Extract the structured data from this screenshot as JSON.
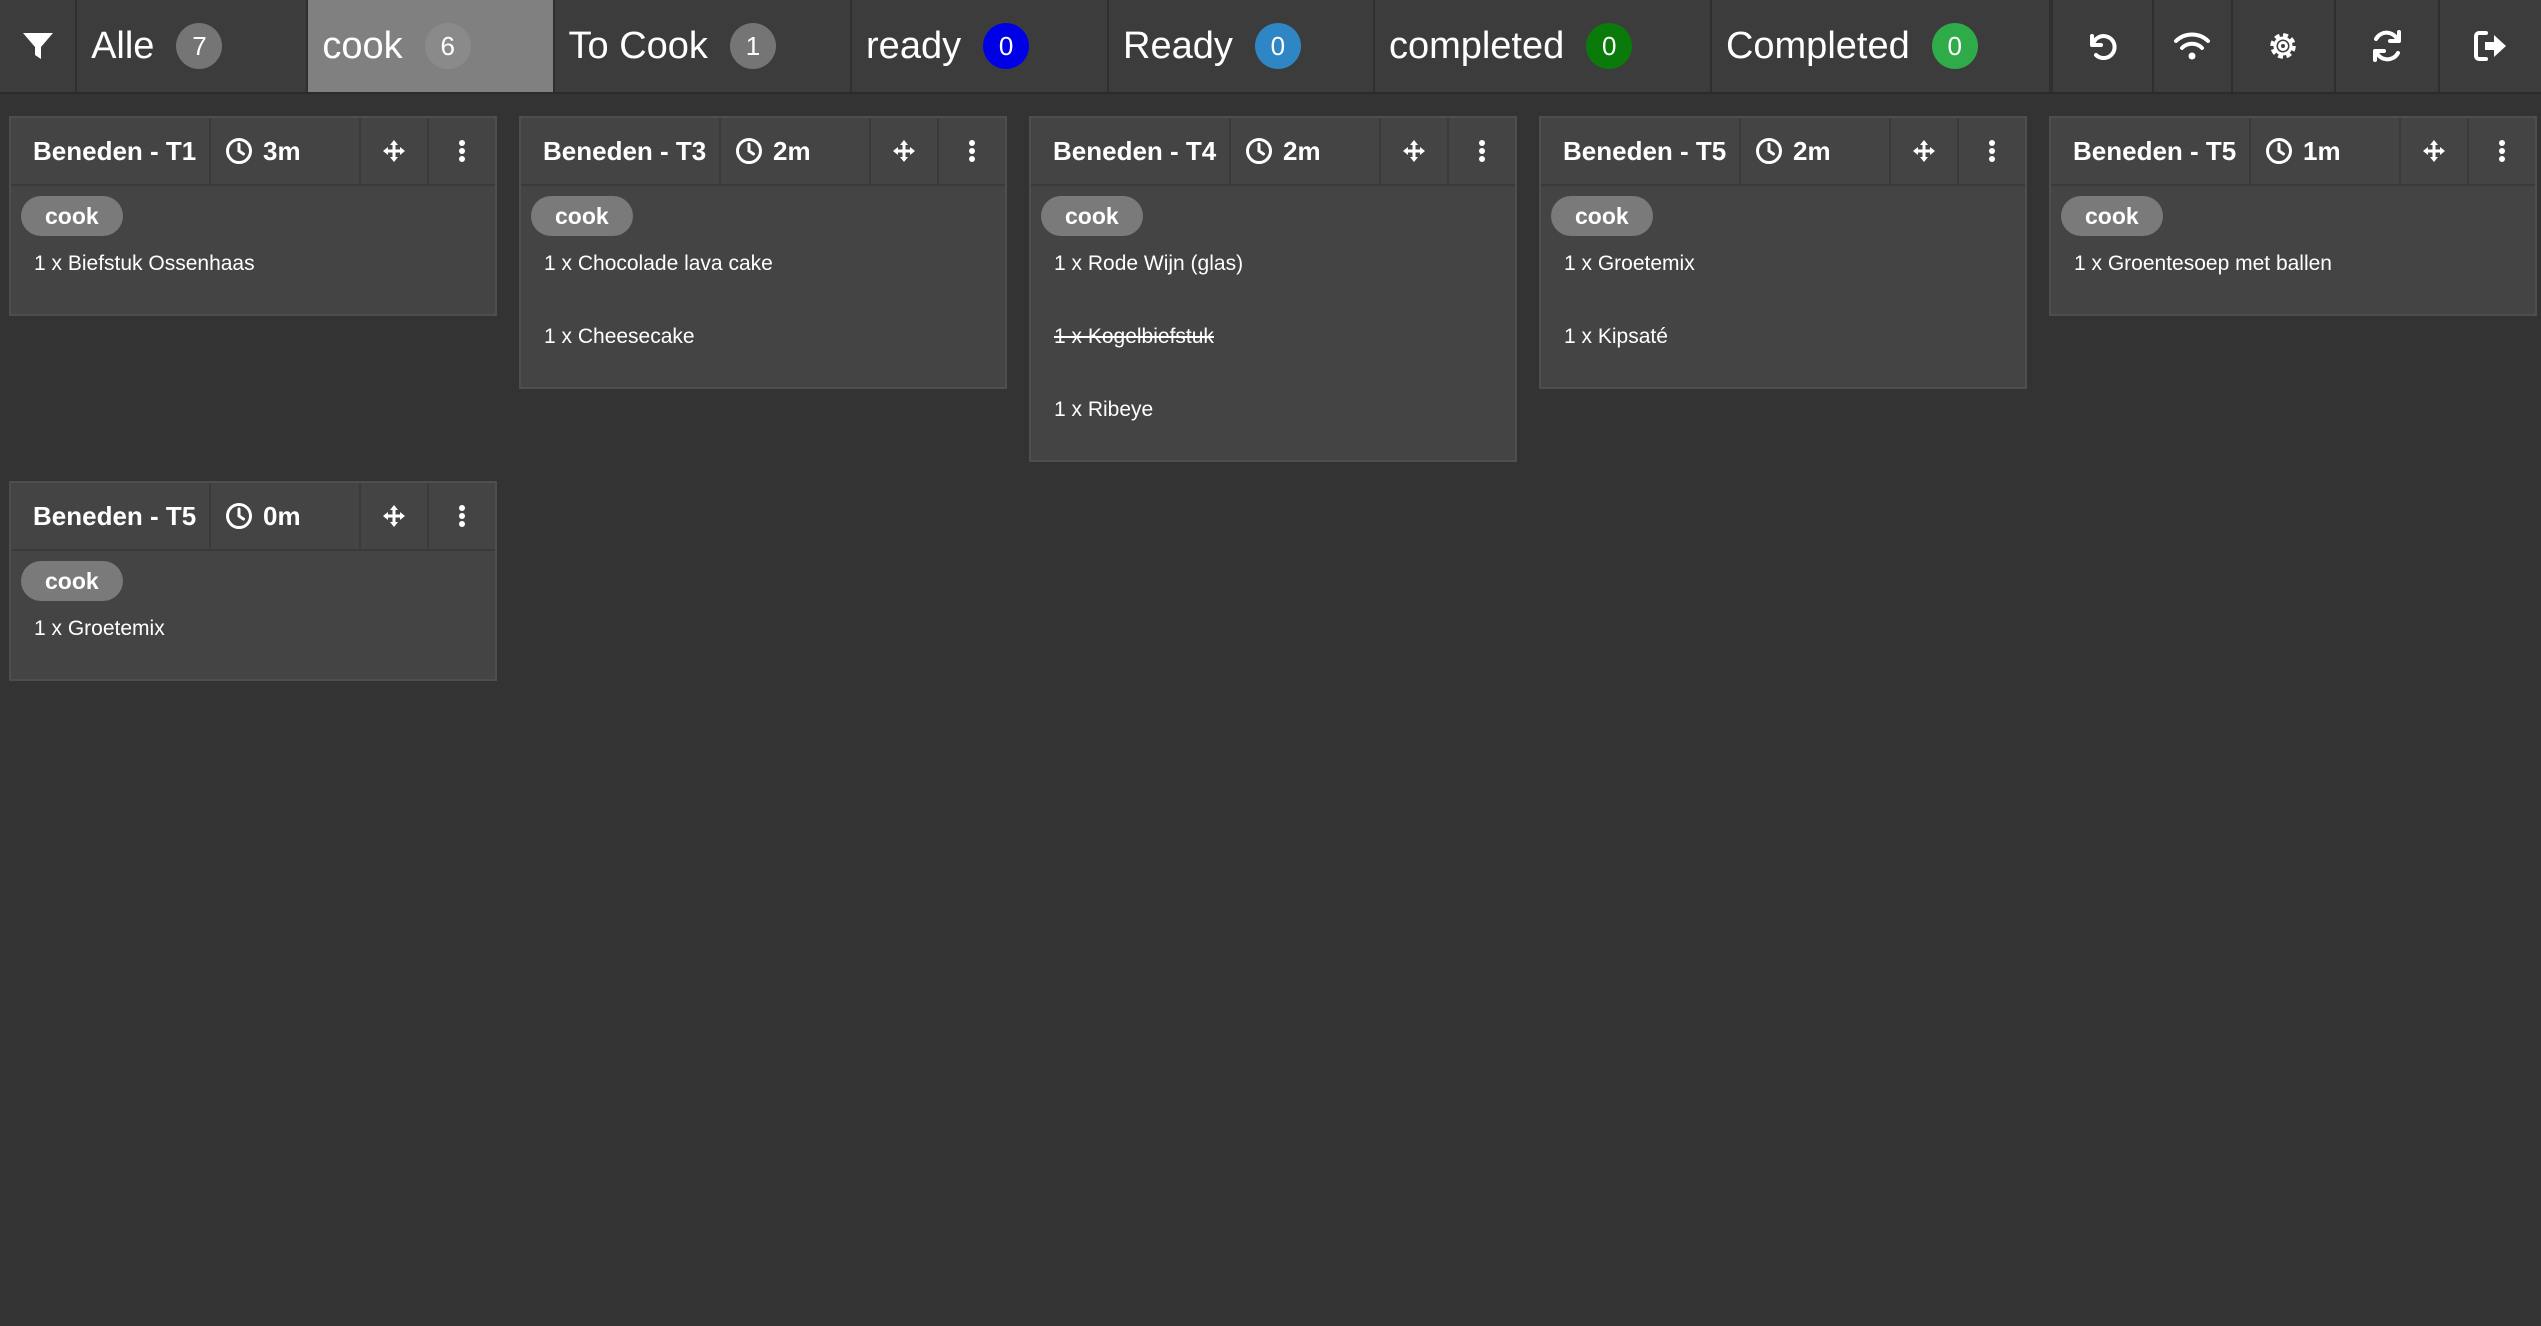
{
  "tabs": [
    {
      "label": "Alle",
      "count": "7",
      "badge_color": "#757575",
      "active": false
    },
    {
      "label": "cook",
      "count": "6",
      "badge_color": "#8a8a8a",
      "active": true
    },
    {
      "label": "To Cook",
      "count": "1",
      "badge_color": "#757575",
      "active": false
    },
    {
      "label": "ready",
      "count": "0",
      "badge_color": "#0000e6",
      "active": false
    },
    {
      "label": "Ready",
      "count": "0",
      "badge_color": "#2f86c4",
      "active": false
    },
    {
      "label": "completed",
      "count": "0",
      "badge_color": "#0a7a0a",
      "active": false
    },
    {
      "label": "Completed",
      "count": "0",
      "badge_color": "#2fab4a",
      "active": false
    }
  ],
  "toolbar_icons": [
    "undo-icon",
    "wifi-icon",
    "settings-icon",
    "refresh-icon",
    "logout-icon"
  ],
  "icons": {
    "filter": "filter-icon",
    "clock": "clock-icon",
    "move": "move-icon",
    "menu": "more-vertical-icon"
  },
  "orders": [
    {
      "table": "Beneden - T1",
      "elapsed": "3m",
      "status": "cook",
      "items": [
        {
          "text": "1 x Biefstuk Ossenhaas",
          "struck": false
        }
      ]
    },
    {
      "table": "Beneden - T3",
      "elapsed": "2m",
      "status": "cook",
      "items": [
        {
          "text": "1 x Chocolade lava cake",
          "struck": false
        },
        {
          "text": "1 x Cheesecake",
          "struck": false
        }
      ]
    },
    {
      "table": "Beneden - T4",
      "elapsed": "2m",
      "status": "cook",
      "items": [
        {
          "text": "1 x Rode Wijn (glas)",
          "struck": false
        },
        {
          "text": "1 x Kogelbiefstuk",
          "struck": true
        },
        {
          "text": "1 x Ribeye",
          "struck": false
        }
      ]
    },
    {
      "table": "Beneden - T5",
      "elapsed": "2m",
      "status": "cook",
      "items": [
        {
          "text": "1 x Groetemix",
          "struck": false
        },
        {
          "text": "1 x Kipsaté",
          "struck": false
        }
      ]
    },
    {
      "table": "Beneden - T5",
      "elapsed": "1m",
      "status": "cook",
      "items": [
        {
          "text": "1 x Groentesoep met ballen",
          "struck": false
        }
      ]
    },
    {
      "table": "Beneden - T5",
      "elapsed": "0m",
      "status": "cook",
      "items": [
        {
          "text": "1 x Groetemix",
          "struck": false
        }
      ]
    }
  ]
}
